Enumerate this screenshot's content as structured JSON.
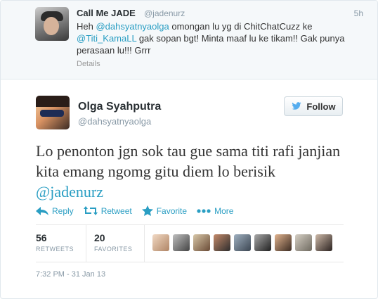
{
  "reply": {
    "name": "Call Me JADE",
    "handle": "@jadenurz",
    "time": "5h",
    "text_before": "Heh ",
    "mention1": "@dahsyatnyaolga",
    "text_middle": " omongan lu yg di ChitChatCuzz ke ",
    "mention2": "@Titi_KamaLL",
    "text_after": " gak sopan bgt! Minta maaf lu ke tikam!! Gak punya perasaan lu!!! Grrr",
    "details": "Details"
  },
  "tweet": {
    "name": "Olga Syahputra",
    "handle": "@dahsyatnyaolga",
    "follow_label": "Follow",
    "text": "Lo penonton jgn sok tau gue sama titi rafi janjian kita emang ngomg gitu diem lo berisik ",
    "mention": "@jadenurz",
    "actions": {
      "reply": "Reply",
      "retweet": "Retweet",
      "favorite": "Favorite",
      "more": "More"
    },
    "retweets_count": "56",
    "retweets_label": "RETWEETS",
    "favorites_count": "20",
    "favorites_label": "FAVORITES",
    "timestamp": "7:32 PM - 31 Jan 13"
  },
  "colors": {
    "link": "#2a9ec3",
    "muted": "#8899a6"
  }
}
